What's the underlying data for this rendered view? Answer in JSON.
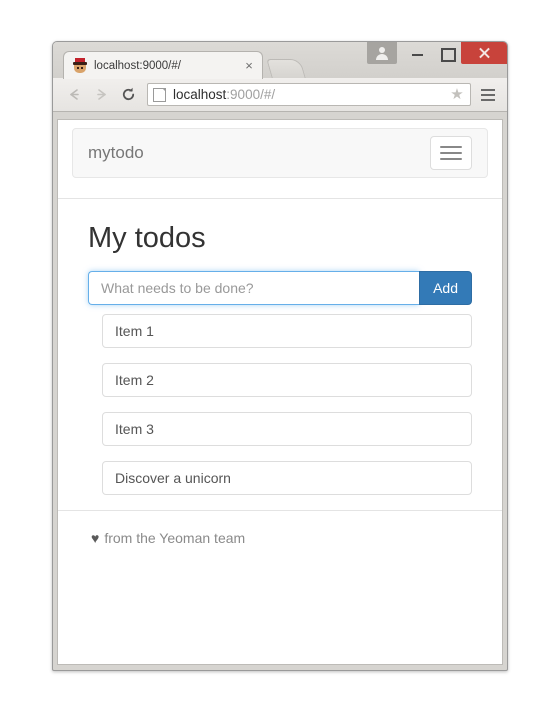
{
  "browser": {
    "tab": {
      "title": "localhost:9000/#/",
      "favicon": "yeoman-favicon",
      "close_label": "×"
    },
    "new_tab_label": "+",
    "window_controls": {
      "user": "user-avatar-icon",
      "minimize": "minimize-icon",
      "maximize": "maximize-icon",
      "close": "close-icon"
    },
    "toolbar": {
      "back": "back-arrow-icon",
      "forward": "forward-arrow-icon",
      "reload": "reload-icon",
      "page_icon": "page-document-icon",
      "url_host": "localhost",
      "url_rest": ":9000/#/",
      "bookmark": "★",
      "menu": "hamburger-menu-icon"
    }
  },
  "page": {
    "navbar": {
      "brand": "mytodo",
      "toggle": "navbar-toggle-icon"
    },
    "title": "My todos",
    "form": {
      "placeholder": "What needs to be done?",
      "value": "",
      "add_label": "Add"
    },
    "todos": [
      {
        "label": "Item 1"
      },
      {
        "label": "Item 2"
      },
      {
        "label": "Item 3"
      },
      {
        "label": "Discover a unicorn"
      }
    ],
    "footer": {
      "heart": "♥",
      "text": "from the Yeoman team"
    }
  },
  "colors": {
    "primary": "#337ab7",
    "focus_border": "#66afe9",
    "navbar_bg": "#f8f8f8",
    "close_btn": "#c8433b",
    "text": "#333333",
    "muted": "#777777"
  }
}
